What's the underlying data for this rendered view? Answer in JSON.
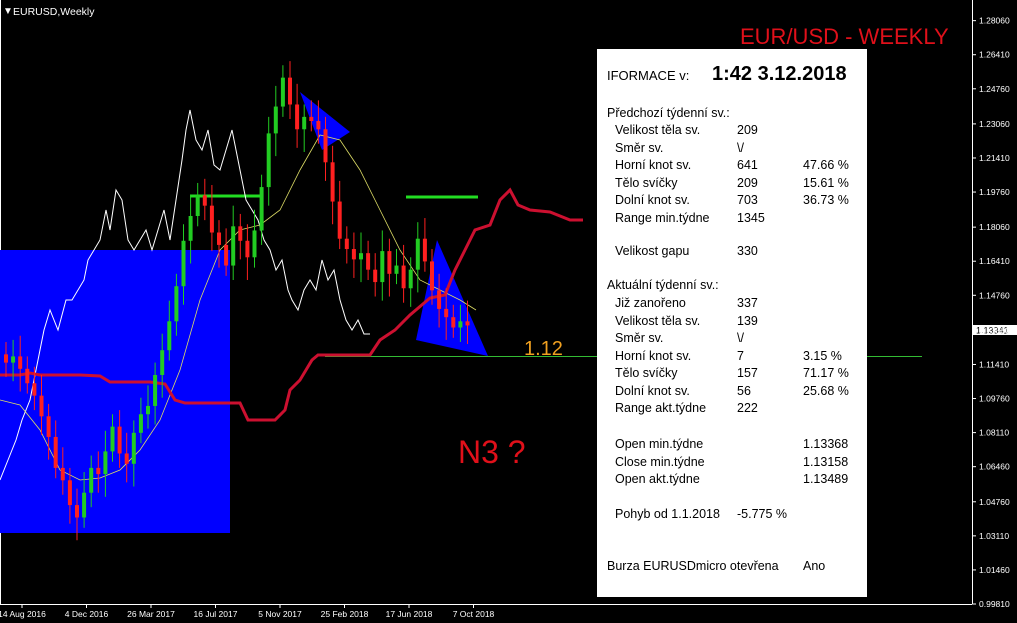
{
  "window": {
    "title": "EURUSD,Weekly"
  },
  "chart_title": "EUR/USD - WEEKLY",
  "annotations": {
    "level": "1.12",
    "pattern": "N3 ?"
  },
  "price_tag": "1.13341",
  "colors": {
    "background": "#000000",
    "bull": "#22cc22",
    "bear": "#ff2020",
    "accent_line": "#cc1030",
    "box": "#0000ff",
    "title": "#e0101a",
    "level": "#f0a020"
  },
  "chart_data": {
    "type": "candlestick",
    "instrument": "EURUSD",
    "timeframe": "Weekly",
    "x_ticks": [
      "14 Aug 2016",
      "4 Dec 2016",
      "26 Mar 2017",
      "16 Jul 2017",
      "5 Nov 2017",
      "25 Feb 2018",
      "17 Jun 2018",
      "7 Oct 2018"
    ],
    "y_ticks": [
      "1.28060",
      "1.26410",
      "1.24760",
      "1.23060",
      "1.21410",
      "1.19760",
      "1.18060",
      "1.16410",
      "1.14760",
      "1.13060",
      "1.11410",
      "1.09760",
      "1.08110",
      "1.06460",
      "1.04760",
      "1.03110",
      "1.01460",
      "0.99810"
    ],
    "ylim": [
      0.9981,
      1.2906
    ],
    "support_level": 1.12,
    "current_price": 1.13341,
    "series": [
      {
        "name": "",
        "role": "close",
        "values": [
          1.115,
          1.118,
          1.112,
          1.105,
          1.099,
          1.089,
          1.079,
          1.064,
          1.058,
          1.046,
          1.04,
          1.052,
          1.064,
          1.061,
          1.072,
          1.084,
          1.071,
          1.066,
          1.081,
          1.09,
          1.094,
          1.109,
          1.121,
          1.135,
          1.152,
          1.174,
          1.186,
          1.196,
          1.191,
          1.178,
          1.172,
          1.162,
          1.181,
          1.174,
          1.166,
          1.179,
          1.2,
          1.226,
          1.239,
          1.253,
          1.24,
          1.228,
          1.234,
          1.232,
          1.228,
          1.212,
          1.193,
          1.175,
          1.17,
          1.165,
          1.168,
          1.16,
          1.154,
          1.169,
          1.158,
          1.162,
          1.151,
          1.16,
          1.175,
          1.164,
          1.15,
          1.141,
          1.137,
          1.132,
          1.135,
          1.133
        ]
      }
    ]
  },
  "info_panel": {
    "header_label": "IFORMACE v:",
    "header_value": "1:42 3.12.2018",
    "prev_section": "Předchozí týdenní sv.:",
    "prev_rows": [
      {
        "label": "Velikost těla sv.",
        "value": "209",
        "pct": ""
      },
      {
        "label": "Směr sv.",
        "value": "\\/",
        "pct": ""
      },
      {
        "label": "Horní knot sv.",
        "value": "641",
        "pct": "47.66 %"
      },
      {
        "label": "Tělo svíčky",
        "value": "209",
        "pct": "15.61 %"
      },
      {
        "label": "Dolní knot sv.",
        "value": "703",
        "pct": "36.73 %"
      },
      {
        "label": "Range min.týdne",
        "value": "1345",
        "pct": ""
      }
    ],
    "gap_label": "Velikost gapu",
    "gap_value": "330",
    "curr_section": "Aktuální týdenní sv.:",
    "curr_rows": [
      {
        "label": "Již zanořeno",
        "value": "337",
        "pct": ""
      },
      {
        "label": "Velikost těla sv.",
        "value": "139",
        "pct": ""
      },
      {
        "label": "Směr sv.",
        "value": "\\/",
        "pct": ""
      },
      {
        "label": "Horní knot sv.",
        "value": "7",
        "pct": "3.15 %"
      },
      {
        "label": "Tělo svíčky",
        "value": "157",
        "pct": "71.17 %"
      },
      {
        "label": "Dolní knot sv.",
        "value": "56",
        "pct": "25.68 %"
      },
      {
        "label": "Range akt.týdne",
        "value": "222",
        "pct": ""
      }
    ],
    "oc_rows": [
      {
        "label": "Open min.týdne",
        "value": "1.13368"
      },
      {
        "label": "Close min.týdne",
        "value": "1.13158"
      },
      {
        "label": "Open akt.týdne",
        "value": "1.13489"
      }
    ],
    "pohyb_label": "Pohyb od 1.1.2018",
    "pohyb_value": "-5.775 %",
    "burza_label": "Burza EURUSDmicro otevřena",
    "burza_value": "Ano"
  }
}
